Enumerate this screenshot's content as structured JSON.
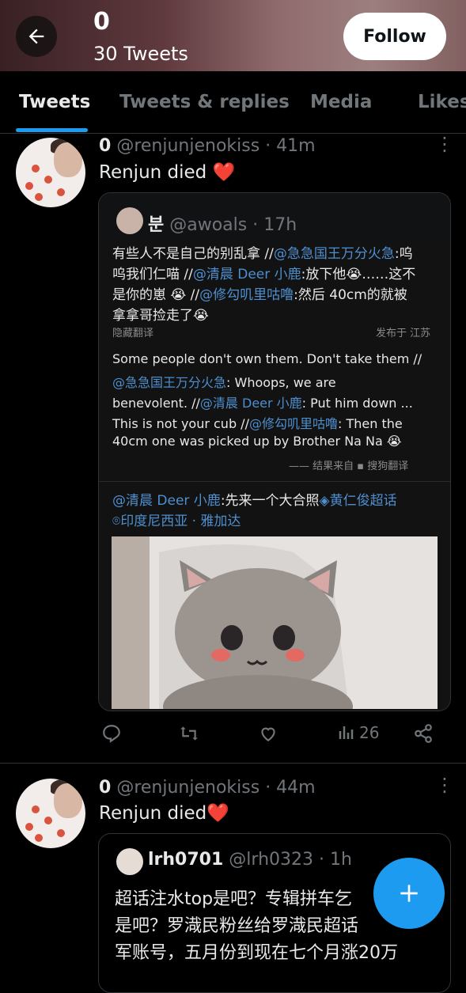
{
  "header": {
    "profile_name": "0",
    "tweet_count": "30 Tweets",
    "follow_label": "Follow"
  },
  "tabs": [
    {
      "label": "Tweets",
      "active": true
    },
    {
      "label": "Tweets & replies",
      "active": false
    },
    {
      "label": "Media",
      "active": false
    },
    {
      "label": "Likes",
      "active": false
    }
  ],
  "tweets": [
    {
      "name": "0",
      "handle": "@renjunjenokiss",
      "time": "· 41m",
      "text": "Renjun died ❤️",
      "quote": {
        "name": "분",
        "handle": "@awoals",
        "time": "· 17h",
        "weibo": {
          "lines": [
            {
              "before": "有些人不是自己的别乱拿 //",
              "mention": "@急急国王万分火急",
              "after": ":呜"
            },
            {
              "before": "呜我们仁喵 //",
              "mention": "@清晨 Deer 小鹿",
              "after": ":放下他😭……这不"
            },
            {
              "before": "是你的崽 😭 //",
              "mention": "@修勾叽里咕噜",
              "after": ":然后 40cm的就被"
            },
            {
              "before": "拿拿哥捡走了😭",
              "mention": "",
              "after": ""
            }
          ],
          "hide_translation": "隐藏翻译",
          "posted_from": "发布于 江苏",
          "translation_lines": [
            {
              "before": " Some people don't own them. Don't take them //",
              "mention": "",
              "after": ""
            },
            {
              "before": "",
              "mention": "@急急国王万分火急",
              "after": ": Whoops, we are"
            },
            {
              "before": "benevolent. //",
              "mention": "@清晨 Deer 小鹿",
              "after": ": Put him down ..."
            },
            {
              "before": "This is not your cub //",
              "mention": "@修勾叽里咕噜",
              "after": ": Then the"
            },
            {
              "before": "40cm one was picked up by Brother Na Na 😭",
              "mention": "",
              "after": ""
            }
          ],
          "translation_credit": "—— 结果来自",
          "translation_source": "搜狗翻译",
          "original_line1_mention": "@清晨 Deer 小鹿",
          "original_line1_text": ":先来一个大合照",
          "original_line1_topic": "黄仁俊超话",
          "location": "印度尼西亚 · 雅加达"
        }
      },
      "actions": {
        "views": "26"
      }
    },
    {
      "name": "0",
      "handle": "@renjunjenokiss",
      "time": "· 44m",
      "text": "Renjun died❤️",
      "quote": {
        "name": "lrh0701",
        "handle": "@lrh0323",
        "time": "· 1h",
        "lines": [
          "超话注水top是吧？专辑拼车乞",
          "是吧？罗渽民粉丝给罗渽民超话",
          "军账号，五月份到现在七个月涨20万"
        ]
      }
    }
  ],
  "icons": {
    "back": "arrow-left-icon",
    "more": "more-vertical-icon",
    "reply": "reply-icon",
    "retweet": "retweet-icon",
    "like": "heart-icon",
    "views": "views-icon",
    "share": "share-icon",
    "compose": "plus-icon"
  },
  "colors": {
    "accent": "#1d9bf0",
    "background": "#000000",
    "secondary_text": "#71767b",
    "mention_blue": "#4d8fcf"
  }
}
